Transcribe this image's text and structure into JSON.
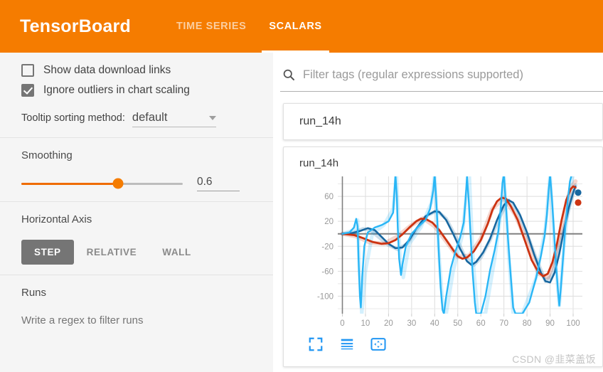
{
  "header": {
    "brand": "TensorBoard",
    "tabs": [
      {
        "label": "TIME SERIES",
        "active": false
      },
      {
        "label": "SCALARS",
        "active": true
      }
    ],
    "accent_color": "#f57c00"
  },
  "sidebar": {
    "checkboxes": [
      {
        "label": "Show data download links",
        "checked": false
      },
      {
        "label": "Ignore outliers in chart scaling",
        "checked": true
      }
    ],
    "tooltip_sorting": {
      "label": "Tooltip sorting method:",
      "value": "default"
    },
    "smoothing": {
      "title": "Smoothing",
      "value": "0.6",
      "fraction": 0.6,
      "fill_color": "#ef6c00"
    },
    "horizontal_axis": {
      "title": "Horizontal Axis",
      "options": [
        {
          "label": "STEP",
          "active": true
        },
        {
          "label": "RELATIVE",
          "active": false
        },
        {
          "label": "WALL",
          "active": false
        }
      ]
    },
    "runs": {
      "title": "Runs",
      "hint": "Write a regex to filter runs"
    }
  },
  "main": {
    "filter": {
      "placeholder": "Filter tags (regular expressions supported)",
      "value": "",
      "icon": "search-icon"
    },
    "run_group_title": "run_14h",
    "chart_toolbar": [
      {
        "icon": "fullscreen-expand-icon"
      },
      {
        "icon": "data-table-icon"
      },
      {
        "icon": "fit-to-domain-icon"
      }
    ],
    "watermark": "CSDN @韭菜盖饭"
  },
  "chart_data": {
    "type": "line",
    "title": "run_14h",
    "xlabel": "",
    "ylabel": "",
    "xlim": [
      -2,
      104
    ],
    "ylim": [
      -128,
      92
    ],
    "xticks": [
      0,
      10,
      20,
      30,
      40,
      50,
      60,
      70,
      80,
      90,
      100
    ],
    "yticks": [
      60,
      20,
      -20,
      -60,
      -100
    ],
    "grid": true,
    "zero_line": true,
    "legend": "none",
    "series": [
      {
        "name": "smoothed-dark-blue",
        "color": "#1767a0",
        "width": 2.6,
        "points": [
          [
            0,
            0
          ],
          [
            4,
            1
          ],
          [
            8,
            5
          ],
          [
            11,
            9
          ],
          [
            14,
            6
          ],
          [
            17,
            -5
          ],
          [
            20,
            -16
          ],
          [
            23,
            -23
          ],
          [
            26,
            -22
          ],
          [
            29,
            -10
          ],
          [
            32,
            8
          ],
          [
            36,
            28
          ],
          [
            40,
            36
          ],
          [
            42,
            35
          ],
          [
            45,
            22
          ],
          [
            48,
            0
          ],
          [
            51,
            -24
          ],
          [
            54,
            -44
          ],
          [
            56,
            -50
          ],
          [
            58,
            -45
          ],
          [
            61,
            -30
          ],
          [
            64,
            -8
          ],
          [
            67,
            22
          ],
          [
            70,
            46
          ],
          [
            72,
            54
          ],
          [
            74,
            50
          ],
          [
            77,
            30
          ],
          [
            80,
            2
          ],
          [
            83,
            -32
          ],
          [
            86,
            -62
          ],
          [
            88,
            -76
          ],
          [
            90,
            -78
          ],
          [
            92,
            -62
          ],
          [
            94,
            -32
          ],
          [
            96,
            6
          ],
          [
            98,
            40
          ],
          [
            100,
            66
          ],
          [
            101,
            76
          ]
        ]
      },
      {
        "name": "raw-dark-blue",
        "color": "#1767a0",
        "width": 5,
        "opacity": 0.22,
        "points": [
          [
            0,
            0
          ],
          [
            5,
            2
          ],
          [
            9,
            8
          ],
          [
            12,
            6
          ],
          [
            16,
            -6
          ],
          [
            20,
            -18
          ],
          [
            24,
            -25
          ],
          [
            28,
            -16
          ],
          [
            32,
            6
          ],
          [
            37,
            30
          ],
          [
            41,
            37
          ],
          [
            45,
            24
          ],
          [
            49,
            -4
          ],
          [
            53,
            -36
          ],
          [
            57,
            -50
          ],
          [
            60,
            -38
          ],
          [
            64,
            -10
          ],
          [
            68,
            26
          ],
          [
            72,
            54
          ],
          [
            76,
            36
          ],
          [
            80,
            0
          ],
          [
            84,
            -40
          ],
          [
            88,
            -76
          ],
          [
            91,
            -66
          ],
          [
            95,
            -6
          ],
          [
            99,
            52
          ],
          [
            101,
            78
          ]
        ]
      },
      {
        "name": "smoothed-red",
        "color": "#cc3311",
        "width": 2.8,
        "points": [
          [
            0,
            0
          ],
          [
            5,
            -2
          ],
          [
            9,
            -7
          ],
          [
            13,
            -13
          ],
          [
            17,
            -16
          ],
          [
            20,
            -15
          ],
          [
            23,
            -10
          ],
          [
            26,
            -1
          ],
          [
            29,
            10
          ],
          [
            32,
            20
          ],
          [
            34,
            24
          ],
          [
            36,
            24
          ],
          [
            39,
            18
          ],
          [
            42,
            6
          ],
          [
            45,
            -10
          ],
          [
            48,
            -26
          ],
          [
            50,
            -36
          ],
          [
            52,
            -40
          ],
          [
            54,
            -38
          ],
          [
            57,
            -28
          ],
          [
            60,
            -10
          ],
          [
            63,
            16
          ],
          [
            65,
            38
          ],
          [
            67,
            52
          ],
          [
            69,
            58
          ],
          [
            71,
            56
          ],
          [
            73,
            44
          ],
          [
            76,
            22
          ],
          [
            79,
            -10
          ],
          [
            82,
            -42
          ],
          [
            85,
            -62
          ],
          [
            87,
            -68
          ],
          [
            89,
            -64
          ],
          [
            91,
            -46
          ],
          [
            93,
            -16
          ],
          [
            95,
            22
          ],
          [
            97,
            54
          ],
          [
            99,
            72
          ],
          [
            100,
            76
          ],
          [
            101,
            74
          ]
        ]
      },
      {
        "name": "raw-red",
        "color": "#cc3311",
        "width": 6,
        "opacity": 0.2,
        "points": [
          [
            0,
            0
          ],
          [
            6,
            -4
          ],
          [
            12,
            -14
          ],
          [
            18,
            -16
          ],
          [
            24,
            -4
          ],
          [
            30,
            14
          ],
          [
            35,
            25
          ],
          [
            40,
            12
          ],
          [
            45,
            -12
          ],
          [
            50,
            -37
          ],
          [
            55,
            -35
          ],
          [
            60,
            -8
          ],
          [
            65,
            40
          ],
          [
            70,
            58
          ],
          [
            75,
            30
          ],
          [
            80,
            -14
          ],
          [
            85,
            -64
          ],
          [
            89,
            -70
          ],
          [
            92,
            -40
          ],
          [
            96,
            30
          ],
          [
            99,
            74
          ],
          [
            101,
            84
          ]
        ]
      },
      {
        "name": "smoothed-cyan-spiky",
        "color": "#29b6f6",
        "width": 2.4,
        "points": [
          [
            0,
            0
          ],
          [
            3,
            2
          ],
          [
            5,
            10
          ],
          [
            6,
            24
          ],
          [
            6.6,
            12
          ],
          [
            7,
            -40
          ],
          [
            7.6,
            -100
          ],
          [
            8,
            -118
          ],
          [
            8.6,
            -70
          ],
          [
            9.5,
            -20
          ],
          [
            11,
            2
          ],
          [
            14,
            10
          ],
          [
            17,
            14
          ],
          [
            20,
            20
          ],
          [
            22,
            34
          ],
          [
            22.6,
            70
          ],
          [
            23,
            95
          ],
          [
            23.6,
            60
          ],
          [
            24,
            10
          ],
          [
            24.6,
            -40
          ],
          [
            25.4,
            -66
          ],
          [
            26,
            -50
          ],
          [
            27.5,
            -20
          ],
          [
            30,
            0
          ],
          [
            33,
            12
          ],
          [
            36,
            22
          ],
          [
            38,
            40
          ],
          [
            39.4,
            70
          ],
          [
            40,
            95
          ],
          [
            40.6,
            58
          ],
          [
            41.4,
            0
          ],
          [
            42,
            -46
          ],
          [
            42.6,
            -86
          ],
          [
            43.4,
            -122
          ],
          [
            44,
            -128
          ],
          [
            45,
            -100
          ],
          [
            47,
            -55
          ],
          [
            49,
            -28
          ],
          [
            51,
            -6
          ],
          [
            52.6,
            18
          ],
          [
            53.4,
            56
          ],
          [
            54,
            92
          ],
          [
            54.8,
            50
          ],
          [
            55.6,
            -6
          ],
          [
            56.4,
            -60
          ],
          [
            57.4,
            -110
          ],
          [
            58,
            -128
          ],
          [
            60,
            -128
          ],
          [
            62,
            -100
          ],
          [
            64,
            -58
          ],
          [
            66,
            -26
          ],
          [
            67.6,
            4
          ],
          [
            68.6,
            40
          ],
          [
            69.4,
            82
          ],
          [
            70,
            95
          ],
          [
            70.8,
            50
          ],
          [
            71.8,
            -10
          ],
          [
            73,
            -70
          ],
          [
            74,
            -118
          ],
          [
            75,
            -128
          ],
          [
            78,
            -128
          ],
          [
            81,
            -110
          ],
          [
            84,
            -70
          ],
          [
            86,
            -36
          ],
          [
            87.6,
            -4
          ],
          [
            88.6,
            30
          ],
          [
            89.4,
            70
          ],
          [
            90,
            95
          ],
          [
            90.8,
            56
          ],
          [
            91.6,
            10
          ],
          [
            92.4,
            -40
          ],
          [
            93.4,
            -90
          ],
          [
            94,
            -115
          ],
          [
            94.6,
            -90
          ],
          [
            95.6,
            -40
          ],
          [
            96.6,
            10
          ],
          [
            97.6,
            52
          ],
          [
            98.6,
            84
          ],
          [
            99.4,
            95
          ],
          [
            101,
            95
          ]
        ]
      },
      {
        "name": "raw-cyan-spiky",
        "color": "#29b6f6",
        "width": 5,
        "opacity": 0.2,
        "points": [
          [
            0,
            0
          ],
          [
            5,
            6
          ],
          [
            6.6,
            22
          ],
          [
            7.4,
            -60
          ],
          [
            8.4,
            -128
          ],
          [
            10,
            -60
          ],
          [
            13,
            0
          ],
          [
            18,
            14
          ],
          [
            22,
            40
          ],
          [
            23.4,
            95
          ],
          [
            25,
            -40
          ],
          [
            26.4,
            -70
          ],
          [
            29,
            -16
          ],
          [
            34,
            10
          ],
          [
            38.6,
            50
          ],
          [
            40,
            95
          ],
          [
            41.6,
            -20
          ],
          [
            43.4,
            -110
          ],
          [
            45,
            -128
          ],
          [
            48,
            -60
          ],
          [
            52,
            -2
          ],
          [
            53.6,
            60
          ],
          [
            55,
            95
          ],
          [
            56.6,
            -40
          ],
          [
            58.6,
            -128
          ],
          [
            62,
            -128
          ],
          [
            66,
            -40
          ],
          [
            68.6,
            30
          ],
          [
            70,
            95
          ],
          [
            72,
            -30
          ],
          [
            74,
            -128
          ],
          [
            78,
            -128
          ],
          [
            84,
            -70
          ],
          [
            88,
            10
          ],
          [
            90,
            95
          ],
          [
            92,
            -30
          ],
          [
            94,
            -115
          ],
          [
            96,
            -20
          ],
          [
            98.6,
            70
          ],
          [
            100,
            95
          ],
          [
            101,
            95
          ]
        ]
      }
    ],
    "endpoint_markers": [
      {
        "series": "smoothed-dark-blue",
        "x": 100,
        "y": 66,
        "color": "#1767a0"
      },
      {
        "series": "smoothed-red",
        "x": 100,
        "y": 50,
        "color": "#cc3311"
      }
    ]
  }
}
